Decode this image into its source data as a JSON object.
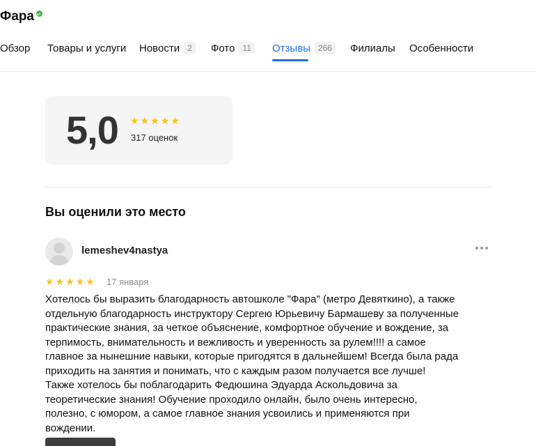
{
  "header": {
    "title": "Фара",
    "verified": true
  },
  "tabs": [
    {
      "label": "Обзор"
    },
    {
      "label": "Товары и услуги"
    },
    {
      "label": "Новости",
      "count": "2"
    },
    {
      "label": "Фото",
      "count": "11"
    },
    {
      "label": "Отзывы",
      "count": "266",
      "active": true
    },
    {
      "label": "Филиалы"
    },
    {
      "label": "Особенности"
    }
  ],
  "rating": {
    "score": "5,0",
    "stars": 5,
    "count_label": "317 оценок"
  },
  "my_review": {
    "section_title": "Вы оценили это место",
    "author": "lemeshev4nastya",
    "stars": 5,
    "date": "17 января",
    "text_lines": [
      "Хотелось бы выразить благодарность автошколе \"Фара\" (метро Девяткино), а также",
      "отдельную благодарность инструктору Сергею Юрьевичу Бармашеву за полученные",
      "практические знания, за четкое объяснение, комфортное обучение и вождение, за",
      "терпимость, внимательность и вежливость и уверенность за рулем!!!! а самое",
      "главное за нынешние навыки, которые пригодятся в дальнейшем! Всегда была рада",
      "приходить на занятия и понимать, что с каждым разом получается все лучше!",
      "Также хотелось бы поблагодарить Федюшина Эдуарда Аскольдовича за",
      "теоретические знания! Обучение проходило онлайн, было очень интересно,",
      "полезно, с юмором, а самое главное знания усвоились и применяются при",
      "вождении."
    ]
  },
  "colors": {
    "accent": "#1f6fe5",
    "star": "#fcc11a",
    "verified": "#3bb54a"
  },
  "icons": {
    "verified": "verified-check-icon",
    "star": "star-icon",
    "more": "more-dots-icon",
    "avatar": "user-avatar-icon"
  }
}
